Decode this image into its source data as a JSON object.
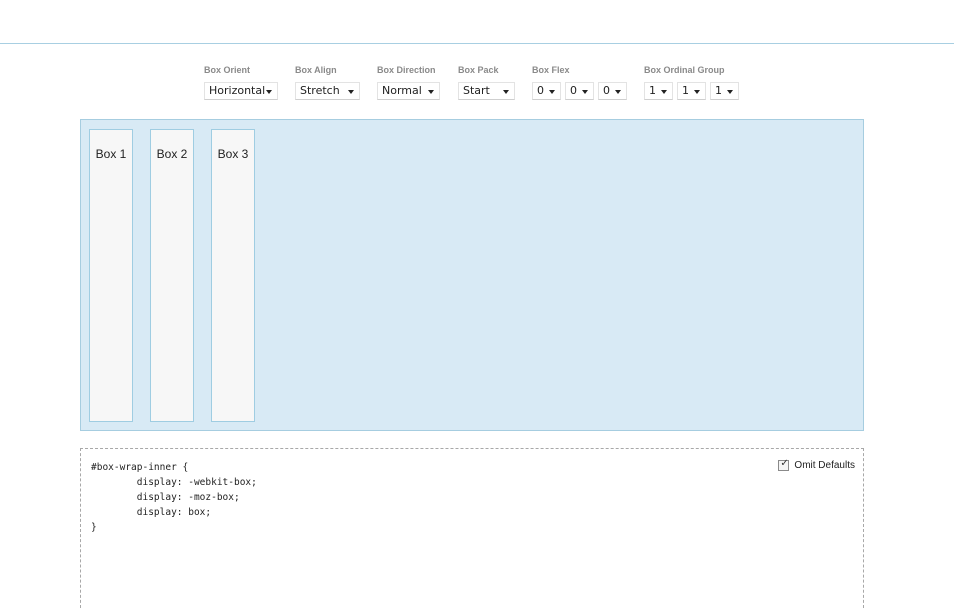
{
  "controls": {
    "box_orient": {
      "label": "Box Orient",
      "value": "Horizontal"
    },
    "box_align": {
      "label": "Box Align",
      "value": "Stretch"
    },
    "box_direction": {
      "label": "Box Direction",
      "value": "Normal"
    },
    "box_pack": {
      "label": "Box Pack",
      "value": "Start"
    },
    "box_flex": {
      "label": "Box Flex",
      "values": [
        "0",
        "0",
        "0"
      ]
    },
    "box_ordinal_group": {
      "label": "Box Ordinal Group",
      "values": [
        "1",
        "1",
        "1"
      ]
    }
  },
  "boxes": [
    "Box 1",
    "Box 2",
    "Box 3"
  ],
  "code": {
    "text": "#box-wrap-inner {\n\tdisplay: -webkit-box;\n\tdisplay: -moz-box;\n\tdisplay: box;\n}",
    "omit_defaults_label": "Omit Defaults",
    "omit_defaults_checked": true,
    "check_glyph": "✓"
  },
  "colors": {
    "stage_bg": "#d8eaf5",
    "accent_border": "#a6cde0",
    "label_gray": "#8a8a8a"
  }
}
